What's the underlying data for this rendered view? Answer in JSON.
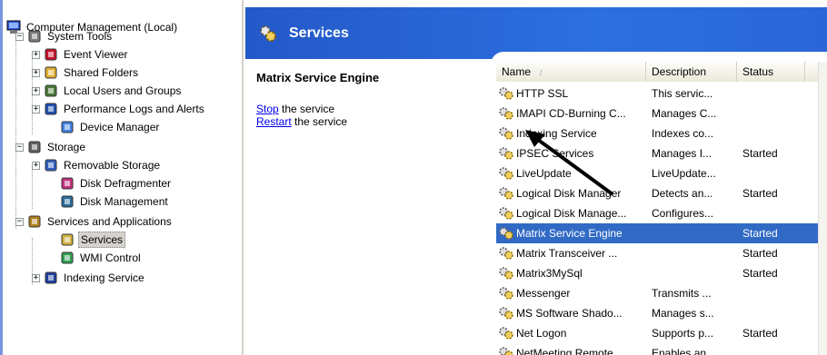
{
  "tree": {
    "root": "Computer Management (Local)",
    "items": [
      {
        "label": "System Tools",
        "expander": "−",
        "icon": "tools-icon"
      },
      {
        "label": "Event Viewer",
        "expander": "+",
        "icon": "event-viewer-icon"
      },
      {
        "label": "Shared Folders",
        "expander": "+",
        "icon": "folder-icon"
      },
      {
        "label": "Local Users and Groups",
        "expander": "+",
        "icon": "users-icon"
      },
      {
        "label": "Performance Logs and Alerts",
        "expander": "+",
        "icon": "performance-icon"
      },
      {
        "label": "Device Manager",
        "expander": "",
        "icon": "device-manager-icon"
      },
      {
        "label": "Storage",
        "expander": "−",
        "icon": "storage-icon"
      },
      {
        "label": "Removable Storage",
        "expander": "+",
        "icon": "removable-storage-icon"
      },
      {
        "label": "Disk Defragmenter",
        "expander": "",
        "icon": "defrag-icon"
      },
      {
        "label": "Disk Management",
        "expander": "",
        "icon": "disk-management-icon"
      },
      {
        "label": "Services and Applications",
        "expander": "−",
        "icon": "services-apps-icon"
      },
      {
        "label": "Services",
        "expander": "",
        "icon": "services-gear-icon",
        "selected": true
      },
      {
        "label": "WMI Control",
        "expander": "",
        "icon": "wmi-icon"
      },
      {
        "label": "Indexing Service",
        "expander": "+",
        "icon": "indexing-icon"
      }
    ]
  },
  "header": {
    "title": "Services"
  },
  "details": {
    "title": "Matrix Service Engine",
    "stop_link": "Stop",
    "stop_rest": " the service",
    "restart_link": "Restart",
    "restart_rest": " the service"
  },
  "list": {
    "columns": {
      "name": "Name",
      "sort": "/",
      "description": "Description",
      "status": "Status"
    },
    "rows": [
      {
        "name": "HTTP SSL",
        "description": "This servic...",
        "status": ""
      },
      {
        "name": "IMAPI CD-Burning C...",
        "description": "Manages C...",
        "status": ""
      },
      {
        "name": "Indexing Service",
        "description": "Indexes co...",
        "status": ""
      },
      {
        "name": "IPSEC Services",
        "description": "Manages I...",
        "status": "Started"
      },
      {
        "name": "LiveUpdate",
        "description": "LiveUpdate...",
        "status": ""
      },
      {
        "name": "Logical Disk Manager",
        "description": "Detects an...",
        "status": "Started"
      },
      {
        "name": "Logical Disk Manage...",
        "description": "Configures...",
        "status": ""
      },
      {
        "name": "Matrix Service Engine",
        "description": "",
        "status": "Started",
        "selected": true
      },
      {
        "name": "Matrix Transceiver ...",
        "description": "",
        "status": "Started"
      },
      {
        "name": "Matrix3MySql",
        "description": "",
        "status": "Started"
      },
      {
        "name": "Messenger",
        "description": "Transmits ...",
        "status": ""
      },
      {
        "name": "MS Software Shado...",
        "description": "Manages s...",
        "status": ""
      },
      {
        "name": "Net Logon",
        "description": "Supports p...",
        "status": "Started"
      },
      {
        "name": "NetMeeting Remote ...",
        "description": "Enables an...",
        "status": ""
      }
    ]
  },
  "colors": {
    "header_blue": "#2c6fe0",
    "selection": "#316ac5",
    "link": "#0000ee"
  }
}
